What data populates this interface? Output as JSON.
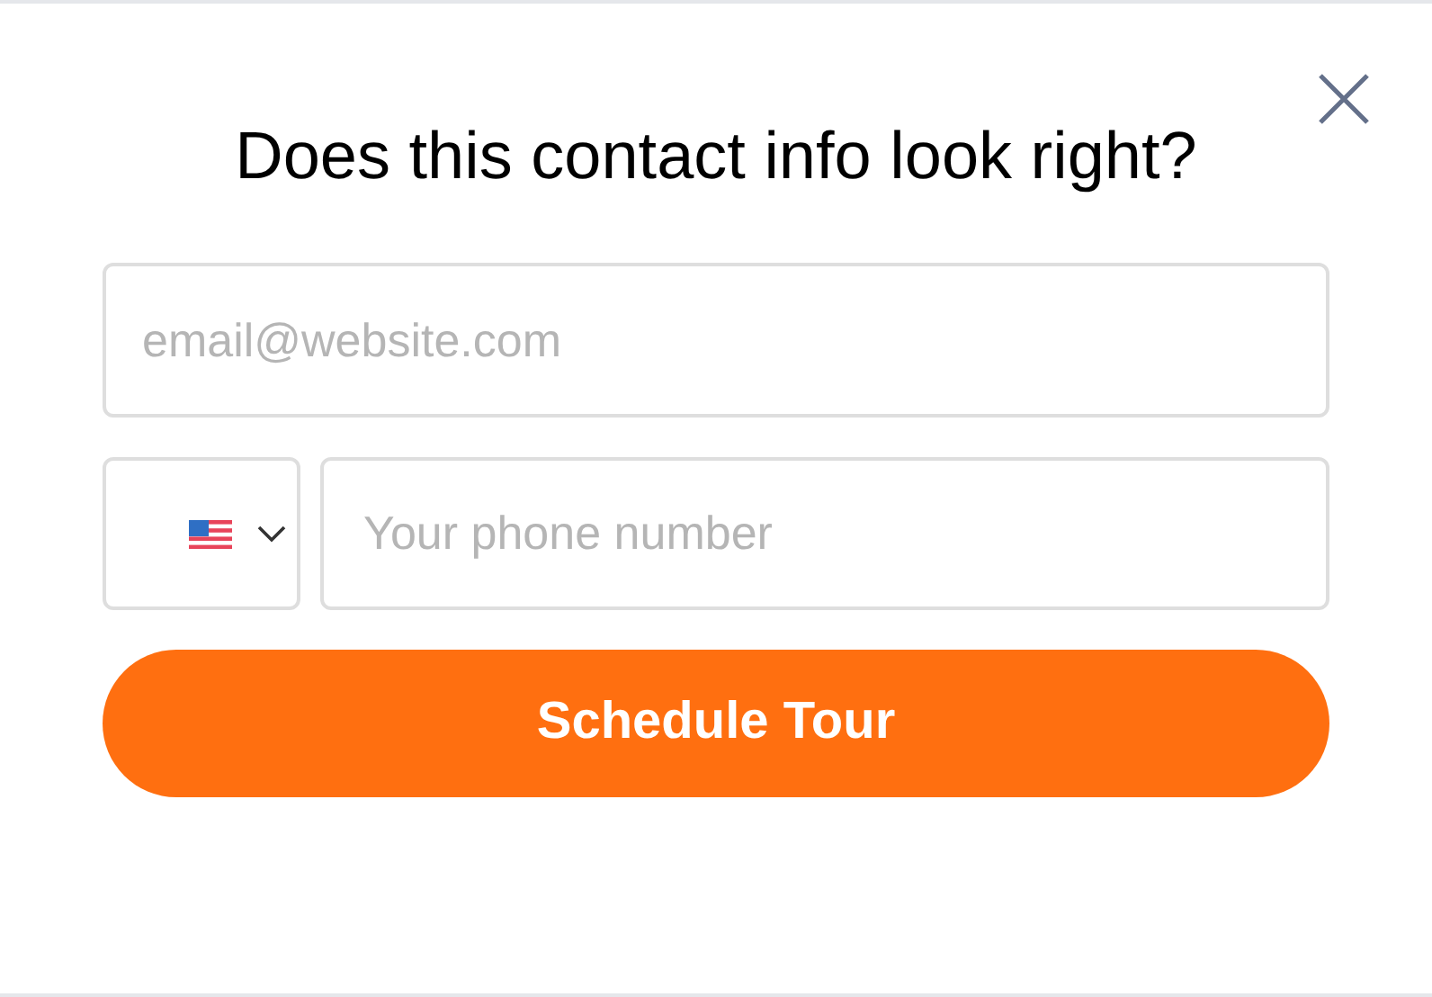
{
  "dialog": {
    "title": "Does this contact info look right?"
  },
  "email": {
    "placeholder": "email@website.com"
  },
  "phone": {
    "placeholder": "Your phone number"
  },
  "submit": {
    "label": "Schedule Tour"
  }
}
